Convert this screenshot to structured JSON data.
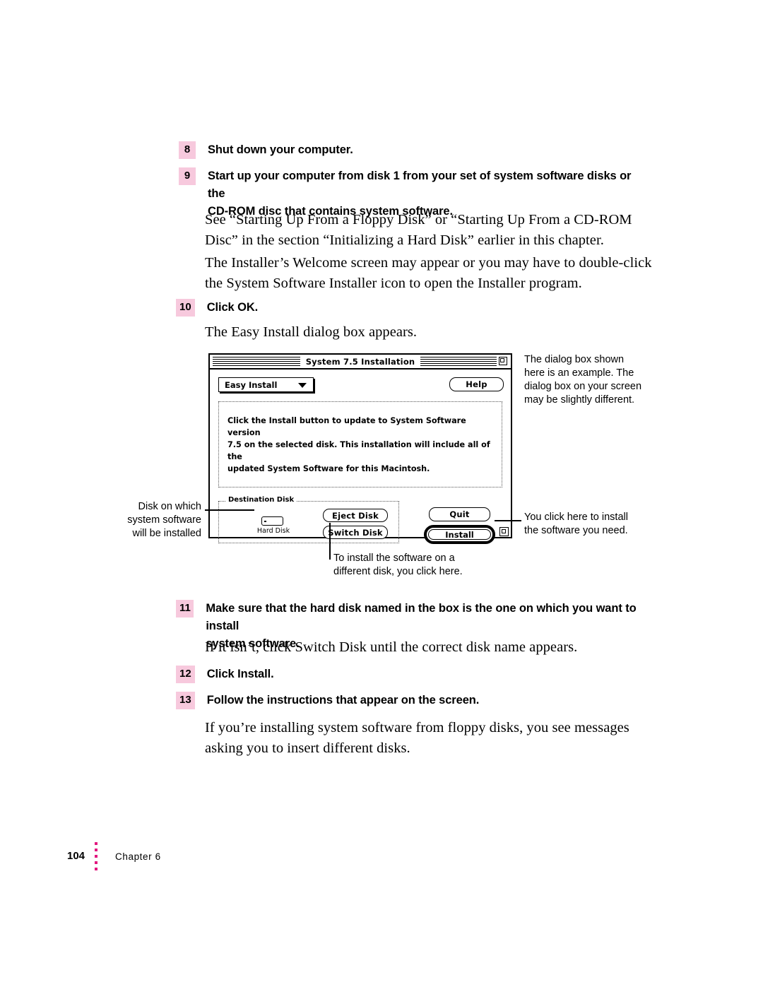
{
  "document": {
    "steps": [
      {
        "number": "8",
        "text": "Shut down your computer."
      },
      {
        "number": "9",
        "text": "Start up your computer from disk 1 from your set of system software disks or the\nCD-ROM disc that contains system software."
      },
      {
        "number": "10",
        "text": "Click OK."
      },
      {
        "number": "11",
        "text": "Make sure that the hard disk named in the box is the one on which you want to install\nsystem software."
      },
      {
        "number": "12",
        "text": "Click Install."
      },
      {
        "number": "13",
        "text": "Follow the instructions that appear on the screen."
      }
    ],
    "paragraphs": {
      "p1": "See “Starting Up From a Floppy Disk” or “Starting Up From a CD-ROM\nDisc” in the section “Initializing a Hard Disk” earlier in this chapter.",
      "p2": "The Installer’s Welcome screen may appear or you may have to double-click\nthe System Software Installer icon to open the Installer program.",
      "p3": "The Easy Install dialog box appears.",
      "p4": "If it isn’t, click Switch Disk until the correct disk name appears.",
      "p5": "If you’re installing system software from floppy disks, you see messages\nasking you to insert different disks."
    },
    "callouts": {
      "top_right": "The dialog box shown\nhere is an example. The\ndialog box on your screen\nmay be slightly different.",
      "left": "Disk on which\nsystem software\nwill be installed",
      "right_bottom": "You click here to install\nthe software you need.",
      "bottom_center": "To install the software on a\ndifferent disk, you click here."
    },
    "footer": {
      "page_number": "104",
      "chapter": "Chapter 6"
    }
  },
  "dialog": {
    "title": "System 7.5 Installation",
    "popup_selected": "Easy Install",
    "popup_icon": "chevron-down-icon",
    "help_label": "Help",
    "message": "Click the Install button to update to System Software version\n7.5 on the selected disk.  This installation will include all of the\nupdated System Software for this Macintosh.",
    "destination_group_label": "Destination Disk",
    "disk_name": "Hard Disk",
    "buttons": {
      "eject": "Eject Disk",
      "switch": "Switch Disk",
      "quit": "Quit",
      "install": "Install"
    }
  },
  "colors": {
    "step_number_background": "#f7c9dd",
    "footer_dots": "#e2187f",
    "text": "#000000",
    "page_background": "#ffffff"
  }
}
